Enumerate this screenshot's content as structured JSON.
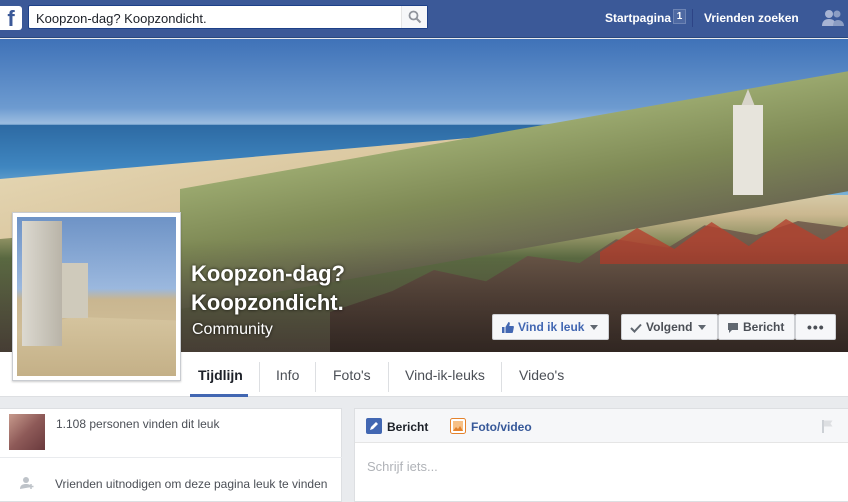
{
  "topbar": {
    "search_value": "Koopzon-dag? Koopzondicht.",
    "home_label": "Startpagina",
    "home_badge": "1",
    "find_friends_label": "Vrienden zoeken",
    "logo_letter": "f",
    "brand_color": "#3b5998"
  },
  "page": {
    "title": "Koopzon-dag? Koopzondicht.",
    "category": "Community"
  },
  "actions": {
    "like_label": "Vind ik leuk",
    "follow_label": "Volgend",
    "message_label": "Bericht",
    "more_label": "•••"
  },
  "tabs": [
    {
      "label": "Tijdlijn",
      "active": true
    },
    {
      "label": "Info"
    },
    {
      "label": "Foto's"
    },
    {
      "label": "Vind-ik-leuks"
    },
    {
      "label": "Video's"
    }
  ],
  "left": {
    "likes_text": "1.108 personen vinden dit leuk",
    "invite_text": "Vrienden uitnodigen om deze pagina leuk te vinden"
  },
  "composer": {
    "tab_post": "Bericht",
    "tab_photo": "Foto/video",
    "placeholder": "Schrijf iets..."
  },
  "icons": [
    "search-icon",
    "friends-icon",
    "thumbs-up-icon",
    "check-icon",
    "message-icon",
    "pencil-icon",
    "photo-icon",
    "flag-icon",
    "add-person-icon"
  ]
}
